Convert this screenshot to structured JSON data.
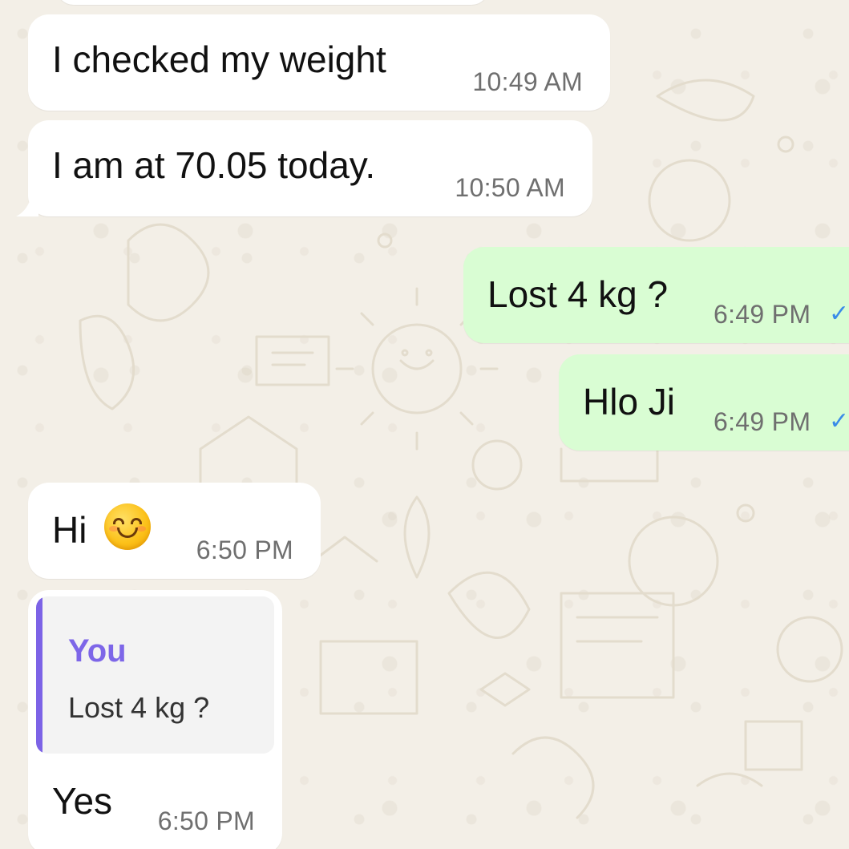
{
  "theme": {
    "incoming_bubble_color": "#ffffff",
    "outgoing_bubble_color": "#d9fdd3",
    "tick_color": "#3a8be8",
    "quote_accent_color": "#7c63e6",
    "background_color": "#f3efe7"
  },
  "messages": [
    {
      "direction": "incoming",
      "text": "I checked my weight",
      "time": "10:49 AM"
    },
    {
      "direction": "incoming",
      "text": "I am at 70.05 today.",
      "time": "10:50 AM"
    },
    {
      "direction": "outgoing",
      "text": "Lost 4 kg ?",
      "time": "6:49 PM",
      "status_icon": "single-check-icon"
    },
    {
      "direction": "outgoing",
      "text": "Hlo Ji",
      "time": "6:49 PM",
      "status_icon": "single-check-icon"
    },
    {
      "direction": "incoming",
      "text": "Hi",
      "emoji": "smiling-face-icon",
      "time": "6:50 PM"
    },
    {
      "direction": "incoming",
      "text": "Yes",
      "time": "6:50 PM",
      "reply_to": {
        "author": "You",
        "text": "Lost 4 kg ?"
      }
    }
  ]
}
